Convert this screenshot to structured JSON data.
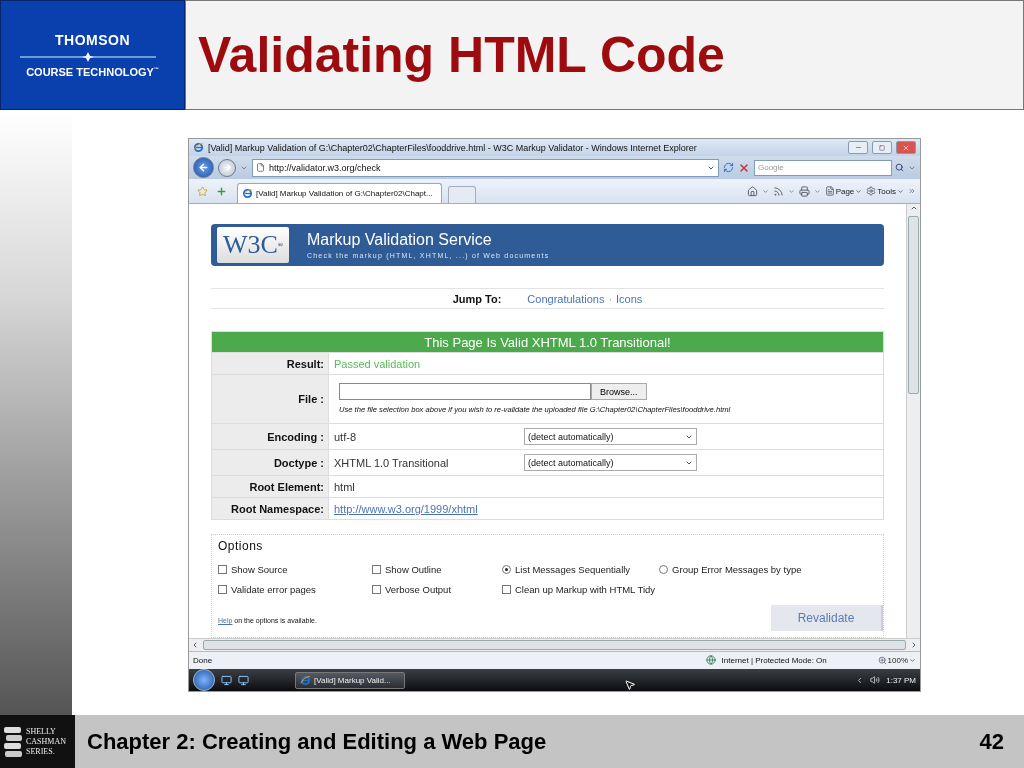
{
  "slide": {
    "logo": {
      "line1": "THOMSON",
      "line2": "COURSE TECHNOLOGY",
      "tm": "™"
    },
    "title": "Validating HTML Code",
    "series": [
      "SHELLY",
      "CASHMAN",
      "SERIES."
    ],
    "footer": "Chapter 2: Creating and Editing a Web Page",
    "page_number": "42"
  },
  "browser": {
    "title": "[Valid] Markup Validation of G:\\Chapter02\\ChapterFiles\\fooddrive.html - W3C Markup Validator - Windows Internet Explorer",
    "address": "http://validator.w3.org/check",
    "search": {
      "placeholder": "Google"
    },
    "tab": {
      "label": "[Valid] Markup Validation of G:\\Chapter02\\Chapt...",
      "selected": true
    },
    "tools": [
      "Page",
      "Tools"
    ],
    "page": {
      "logo": "W3C",
      "logo_mark": "®",
      "heading": "Markup Validation Service",
      "subheading": "Check the markup (HTML, XHTML, ...) of Web documents",
      "jump": {
        "label": "Jump To:",
        "links": [
          "Congratulations",
          "Icons"
        ],
        "separator": "·"
      },
      "result_banner": "This Page Is Valid XHTML 1.0 Transitional!",
      "rows": [
        {
          "kind": "status",
          "label": "Result:",
          "value": "Passed validation"
        },
        {
          "kind": "file",
          "label": "File :",
          "button": "Browse...",
          "note": "Use the file selection box above if you wish to re-validate the uploaded file G:\\Chapter02\\ChapterFiles\\fooddrive.html"
        },
        {
          "kind": "select",
          "label": "Encoding :",
          "value": "utf-8",
          "select": "(detect automatically)"
        },
        {
          "kind": "select",
          "label": "Doctype :",
          "value": "XHTML 1.0 Transitional",
          "select": "(detect automatically)"
        },
        {
          "kind": "plain",
          "label": "Root Element:",
          "value": "html"
        },
        {
          "kind": "link",
          "label": "Root Namespace:",
          "value": "http://www.w3.org/1999/xhtml"
        }
      ],
      "options": {
        "legend": "Options",
        "rows": [
          [
            {
              "kind": "checkbox",
              "label": "Show Source",
              "checked": false
            },
            {
              "kind": "checkbox",
              "label": "Show Outline",
              "checked": false
            },
            {
              "kind": "radio",
              "label": "List Messages Sequentially",
              "selected": true
            },
            {
              "kind": "radio",
              "label": "Group Error Messages by type",
              "selected": false
            }
          ],
          [
            {
              "kind": "checkbox",
              "label": "Validate error pages",
              "checked": false
            },
            {
              "kind": "checkbox",
              "label": "Verbose Output",
              "checked": false
            },
            {
              "kind": "checkbox",
              "label": "Clean up Markup with HTML Tidy",
              "checked": false
            }
          ]
        ],
        "help_link": "Help",
        "help_text": "on the options is available.",
        "button": "Revalidate"
      }
    },
    "status": {
      "text": "Done",
      "zone": "Internet | Protected Mode: On",
      "zoom": "100%"
    },
    "taskbar": {
      "task": "[Valid] Markup Valid...",
      "time": "1:37 PM"
    }
  }
}
